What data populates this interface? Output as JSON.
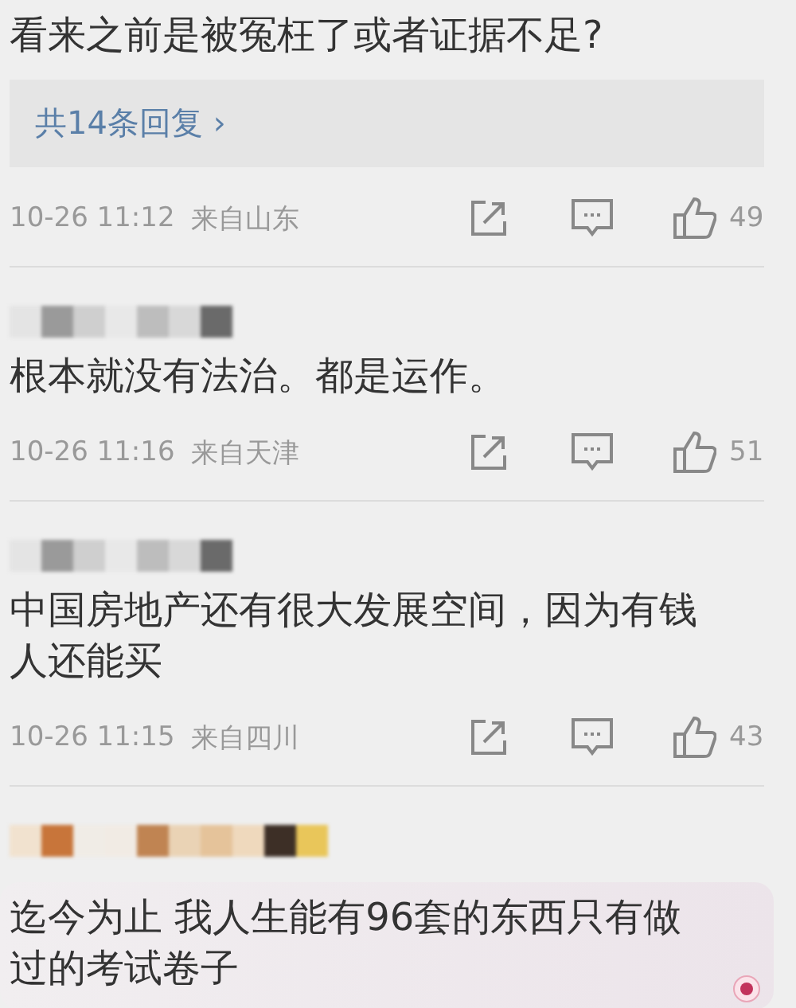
{
  "comments": [
    {
      "kind": "plain",
      "lines": [
        "看来之前是被冤枉了或者证据不足?"
      ],
      "replies": "共14条回复",
      "chevron": "›",
      "time": "10-26 11:12",
      "location": "来自山东",
      "likes": "49"
    },
    {
      "kind": "plain",
      "author": {
        "kind": "gray"
      },
      "lines": [
        "根本就没有法治。都是运作。"
      ],
      "time": "10-26 11:16",
      "location": "来自天津",
      "likes": "51"
    },
    {
      "kind": "plain",
      "author": {
        "kind": "gray"
      },
      "lines": [
        "中国房地产还有很大发展空间，因为有钱",
        "人还能买"
      ],
      "time": "10-26 11:15",
      "location": "来自四川",
      "likes": "43"
    },
    {
      "kind": "bubble",
      "author": {
        "kind": "warm"
      },
      "lines": [
        "迄今为止 我人生能有96套的东西只有做",
        "过的考试卷子"
      ]
    }
  ]
}
